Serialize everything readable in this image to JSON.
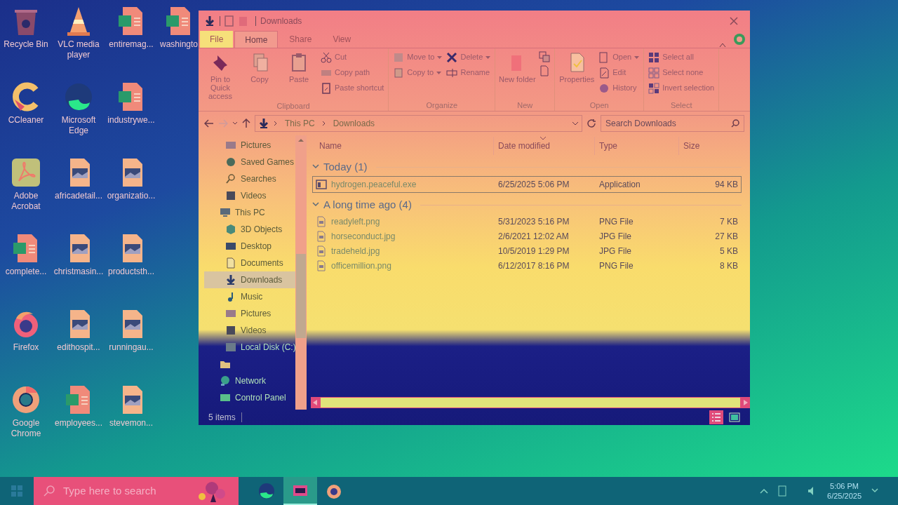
{
  "desktop_icons": [
    {
      "label": "Recycle Bin",
      "kind": "recycle"
    },
    {
      "label": "VLC media player",
      "kind": "vlc"
    },
    {
      "label": "entiremag...",
      "kind": "word"
    },
    {
      "label": "washingto",
      "kind": "word"
    },
    {
      "label": "CCleaner",
      "kind": "ccleaner"
    },
    {
      "label": "Microsoft Edge",
      "kind": "edge"
    },
    {
      "label": "industrywe...",
      "kind": "word"
    },
    {
      "label": "Adobe Acrobat",
      "kind": "acrobat"
    },
    {
      "label": "africadetail...",
      "kind": "image"
    },
    {
      "label": "organizatio...",
      "kind": "image"
    },
    {
      "label": "complete...",
      "kind": "word"
    },
    {
      "label": "christmasin...",
      "kind": "image"
    },
    {
      "label": "productsth...",
      "kind": "image"
    },
    {
      "label": "Firefox",
      "kind": "firefox"
    },
    {
      "label": "edithospit...",
      "kind": "image"
    },
    {
      "label": "runningau...",
      "kind": "image"
    },
    {
      "label": "Google Chrome",
      "kind": "chrome"
    },
    {
      "label": "employees...",
      "kind": "word"
    },
    {
      "label": "stevemon...",
      "kind": "image"
    }
  ],
  "window": {
    "title": "Downloads",
    "tabs": [
      {
        "label": "File",
        "selected": false,
        "kind": "file"
      },
      {
        "label": "Home",
        "selected": true,
        "kind": "tab"
      },
      {
        "label": "Share",
        "selected": false,
        "kind": "tab"
      },
      {
        "label": "View",
        "selected": false,
        "kind": "tab"
      }
    ],
    "ribbon": [
      {
        "label": "Clipboard",
        "buttons": [
          {
            "label": "Pin to Quick access",
            "kind": "large"
          },
          {
            "label": "Copy",
            "kind": "large"
          },
          {
            "label": "Paste",
            "kind": "large"
          },
          {
            "label": "Cut",
            "kind": "small"
          },
          {
            "label": "Copy path",
            "kind": "small"
          },
          {
            "label": "Paste shortcut",
            "kind": "small"
          }
        ]
      },
      {
        "label": "Organize",
        "buttons": [
          {
            "label": "Move to",
            "kind": "small",
            "dropdown": true
          },
          {
            "label": "Copy to",
            "kind": "small",
            "dropdown": true
          },
          {
            "label": "Delete",
            "kind": "small",
            "dropdown": true
          },
          {
            "label": "Rename",
            "kind": "small"
          }
        ]
      },
      {
        "label": "New",
        "buttons": [
          {
            "label": "New folder",
            "kind": "large"
          }
        ]
      },
      {
        "label": "Open",
        "buttons": [
          {
            "label": "Properties",
            "kind": "large"
          },
          {
            "label": "Open",
            "kind": "small",
            "dropdown": true
          },
          {
            "label": "Edit",
            "kind": "small"
          },
          {
            "label": "History",
            "kind": "small"
          }
        ]
      },
      {
        "label": "Select",
        "buttons": [
          {
            "label": "Select all",
            "kind": "small"
          },
          {
            "label": "Select none",
            "kind": "small"
          },
          {
            "label": "Invert selection",
            "kind": "small"
          }
        ]
      }
    ],
    "breadcrumb": [
      "This PC",
      "Downloads"
    ],
    "search": {
      "placeholder": "Search Downloads"
    },
    "nav": [
      {
        "label": "Pictures",
        "selected": false
      },
      {
        "label": "Saved Games",
        "selected": false
      },
      {
        "label": "Searches",
        "selected": false
      },
      {
        "label": "Videos",
        "selected": false
      },
      {
        "label": "This PC",
        "selected": false
      },
      {
        "label": "3D Objects",
        "selected": false
      },
      {
        "label": "Desktop",
        "selected": false
      },
      {
        "label": "Documents",
        "selected": false
      },
      {
        "label": "Downloads",
        "selected": true
      },
      {
        "label": "Music",
        "selected": false
      },
      {
        "label": "Pictures",
        "selected": false
      },
      {
        "label": "Videos",
        "selected": false
      },
      {
        "label": "Local Disk (C:)",
        "selected": false
      },
      {
        "selected": false
      },
      {
        "label": "Network",
        "selected": false
      },
      {
        "label": "Control Panel",
        "selected": false
      }
    ],
    "columns": [
      "Name",
      "Date modified",
      "Type",
      "Size"
    ],
    "groups": [
      {
        "title": "Today (1)",
        "expanded": true,
        "files": [
          {
            "name": "hydrogen.peaceful.exe",
            "date": "6/25/2025 5:06 PM",
            "type": "Application",
            "size": "94 KB",
            "kind": "app",
            "selected": true
          }
        ]
      },
      {
        "title": "A long time ago (4)",
        "expanded": true,
        "files": [
          {
            "name": "readyleft.png",
            "date": "5/31/2023 5:16 PM",
            "type": "PNG File",
            "size": "7 KB",
            "kind": "image",
            "selected": false
          },
          {
            "name": "horseconduct.jpg",
            "date": "2/6/2021 12:02 AM",
            "type": "JPG File",
            "size": "27 KB",
            "kind": "image",
            "selected": false
          },
          {
            "name": "tradeheld.jpg",
            "date": "10/5/2019 1:29 PM",
            "type": "JPG File",
            "size": "5 KB",
            "kind": "image",
            "selected": false
          },
          {
            "name": "officemillion.png",
            "date": "6/12/2017 8:16 PM",
            "type": "PNG File",
            "size": "8 KB",
            "kind": "image",
            "selected": false
          }
        ]
      }
    ],
    "status": "5 items"
  },
  "taskbar": {
    "search_placeholder": "Type here to search",
    "apps": [
      {
        "kind": "edge",
        "selected": false
      },
      {
        "kind": "explorer",
        "selected": true
      },
      {
        "kind": "firefox",
        "selected": false
      }
    ],
    "time": "5:06 PM",
    "date": "6/25/2025"
  }
}
